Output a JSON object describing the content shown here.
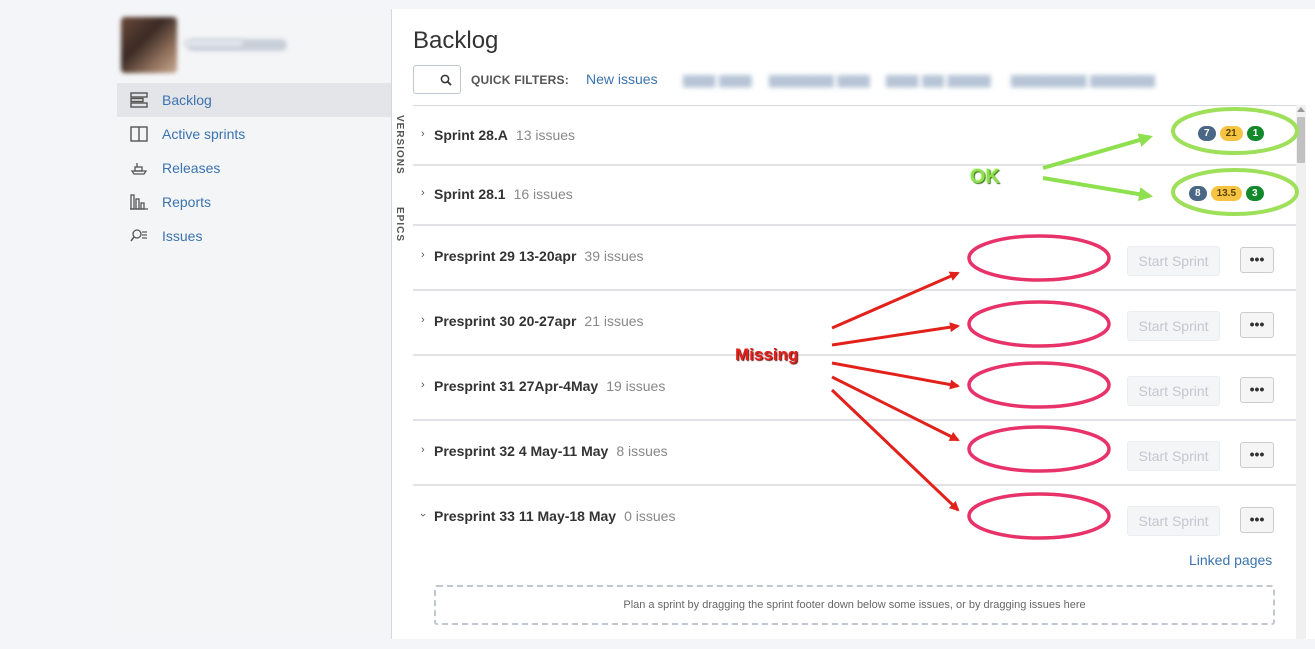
{
  "sidebar": {
    "items": [
      {
        "label": "Backlog",
        "icon": "backlog-icon",
        "active": true
      },
      {
        "label": "Active sprints",
        "icon": "board-icon",
        "active": false
      },
      {
        "label": "Releases",
        "icon": "ship-icon",
        "active": false
      },
      {
        "label": "Reports",
        "icon": "chart-icon",
        "active": false
      },
      {
        "label": "Issues",
        "icon": "search-list-icon",
        "active": false
      }
    ]
  },
  "header": {
    "title": "Backlog",
    "quick_filters_label": "QUICK FILTERS:",
    "quick_filters": [
      "New issues"
    ]
  },
  "side_tabs": {
    "versions": "VERSIONS",
    "epics": "EPICS"
  },
  "sprints": [
    {
      "name": "Sprint 28.A",
      "count": "13 issues",
      "badges": [
        "7",
        "21",
        "1"
      ]
    },
    {
      "name": "Sprint 28.1",
      "count": "16 issues",
      "badges": [
        "8",
        "13.5",
        "3"
      ]
    },
    {
      "name": "Presprint 29 13-20apr",
      "count": "39 issues"
    },
    {
      "name": "Presprint 30 20-27apr",
      "count": "21 issues"
    },
    {
      "name": "Presprint 31 27Apr-4May",
      "count": "19 issues"
    },
    {
      "name": "Presprint 32 4 May-11 May",
      "count": "8 issues"
    },
    {
      "name": "Presprint 33 11 May-18 May",
      "count": "0 issues"
    }
  ],
  "actions": {
    "start_sprint": "Start Sprint",
    "more": "•••"
  },
  "linked_pages": "Linked pages",
  "plan_hint": "Plan a sprint by dragging the sprint footer down below some issues, or by dragging issues here",
  "annotations": {
    "ok": "OK",
    "missing": "Missing"
  },
  "colors": {
    "link": "#3b73af",
    "ok_green": "#8ee04e",
    "missing_red": "#e3211b",
    "ellipse_red": "#e8336a",
    "ellipse_green": "#9ee05a"
  }
}
